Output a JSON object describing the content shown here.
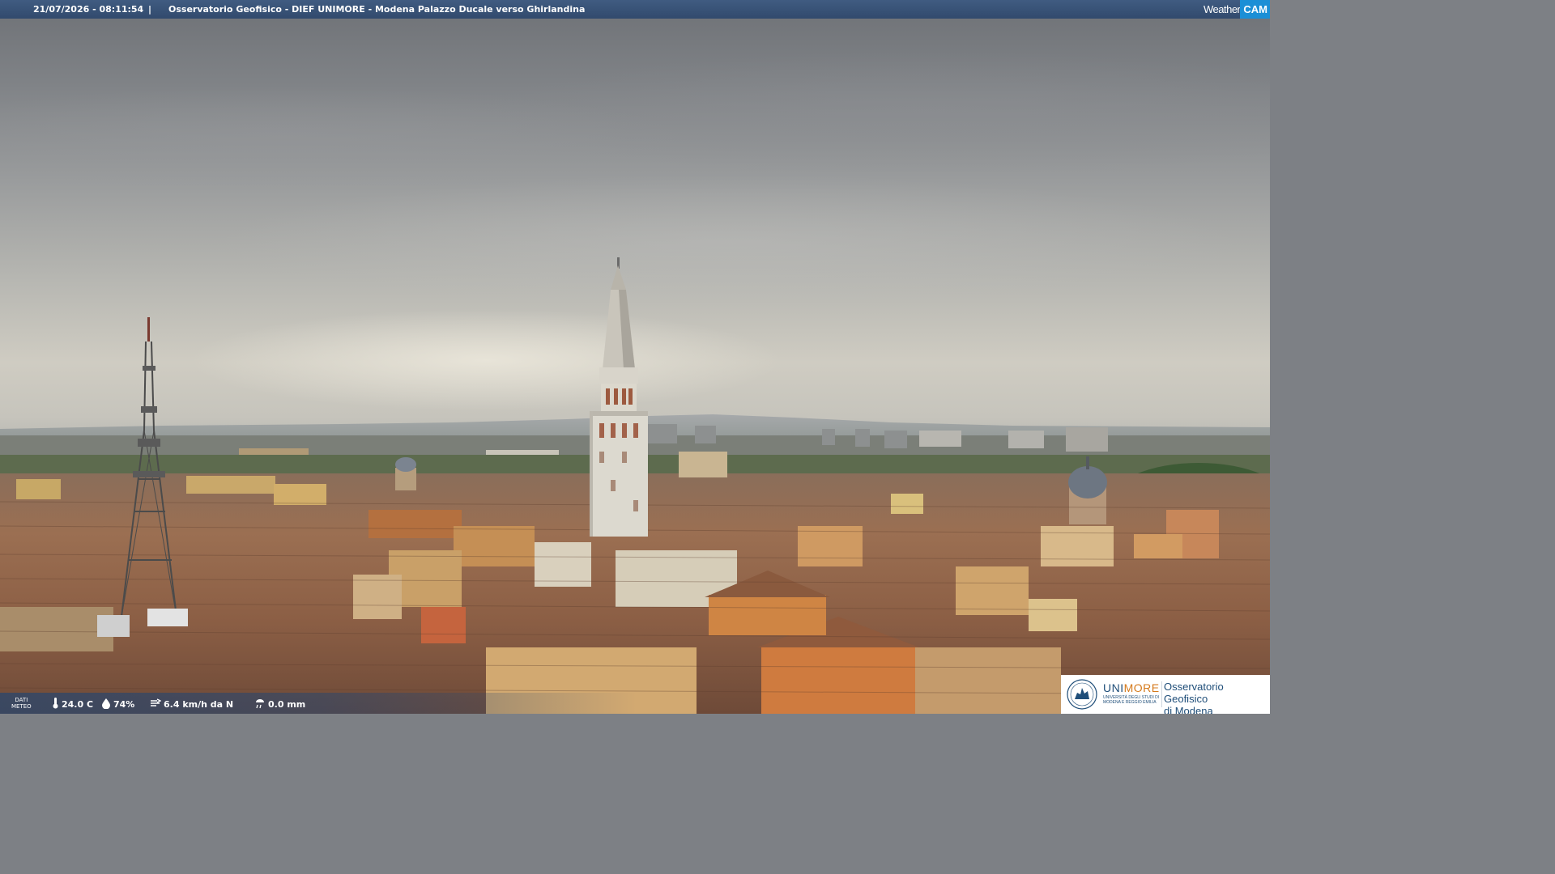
{
  "header": {
    "datetime": "21/07/2026 - 08:11:54",
    "separator": "|",
    "title": "Osservatorio Geofisico - DIEF UNIMORE - Modena Palazzo Ducale verso Ghirlandina",
    "logo_weather": "Weather",
    "logo_cam": "CAM"
  },
  "meteo": {
    "label_line1": "DATI",
    "label_line2": "METEO",
    "temperature": "24.0 C",
    "humidity": "74%",
    "wind": "6.4 km/h da N",
    "rain": "0.0 mm",
    "icons": [
      "thermometer-icon",
      "humidity-icon",
      "wind-icon",
      "rain-gauge-icon"
    ]
  },
  "logo": {
    "uni": "UNI",
    "more": "MORE",
    "subtitle": "UNIVERSITÀ DEGLI STUDI DI MODENA E REGGIO EMILIA",
    "observatory_line1": "Osservatorio Geofisico",
    "observatory_line2": "di Modena"
  },
  "colors": {
    "header_bar": "#2c466c",
    "unimore_blue": "#1f4e79",
    "unimore_orange": "#d57a1c",
    "weathercam_blue": "#1b8fd6"
  }
}
